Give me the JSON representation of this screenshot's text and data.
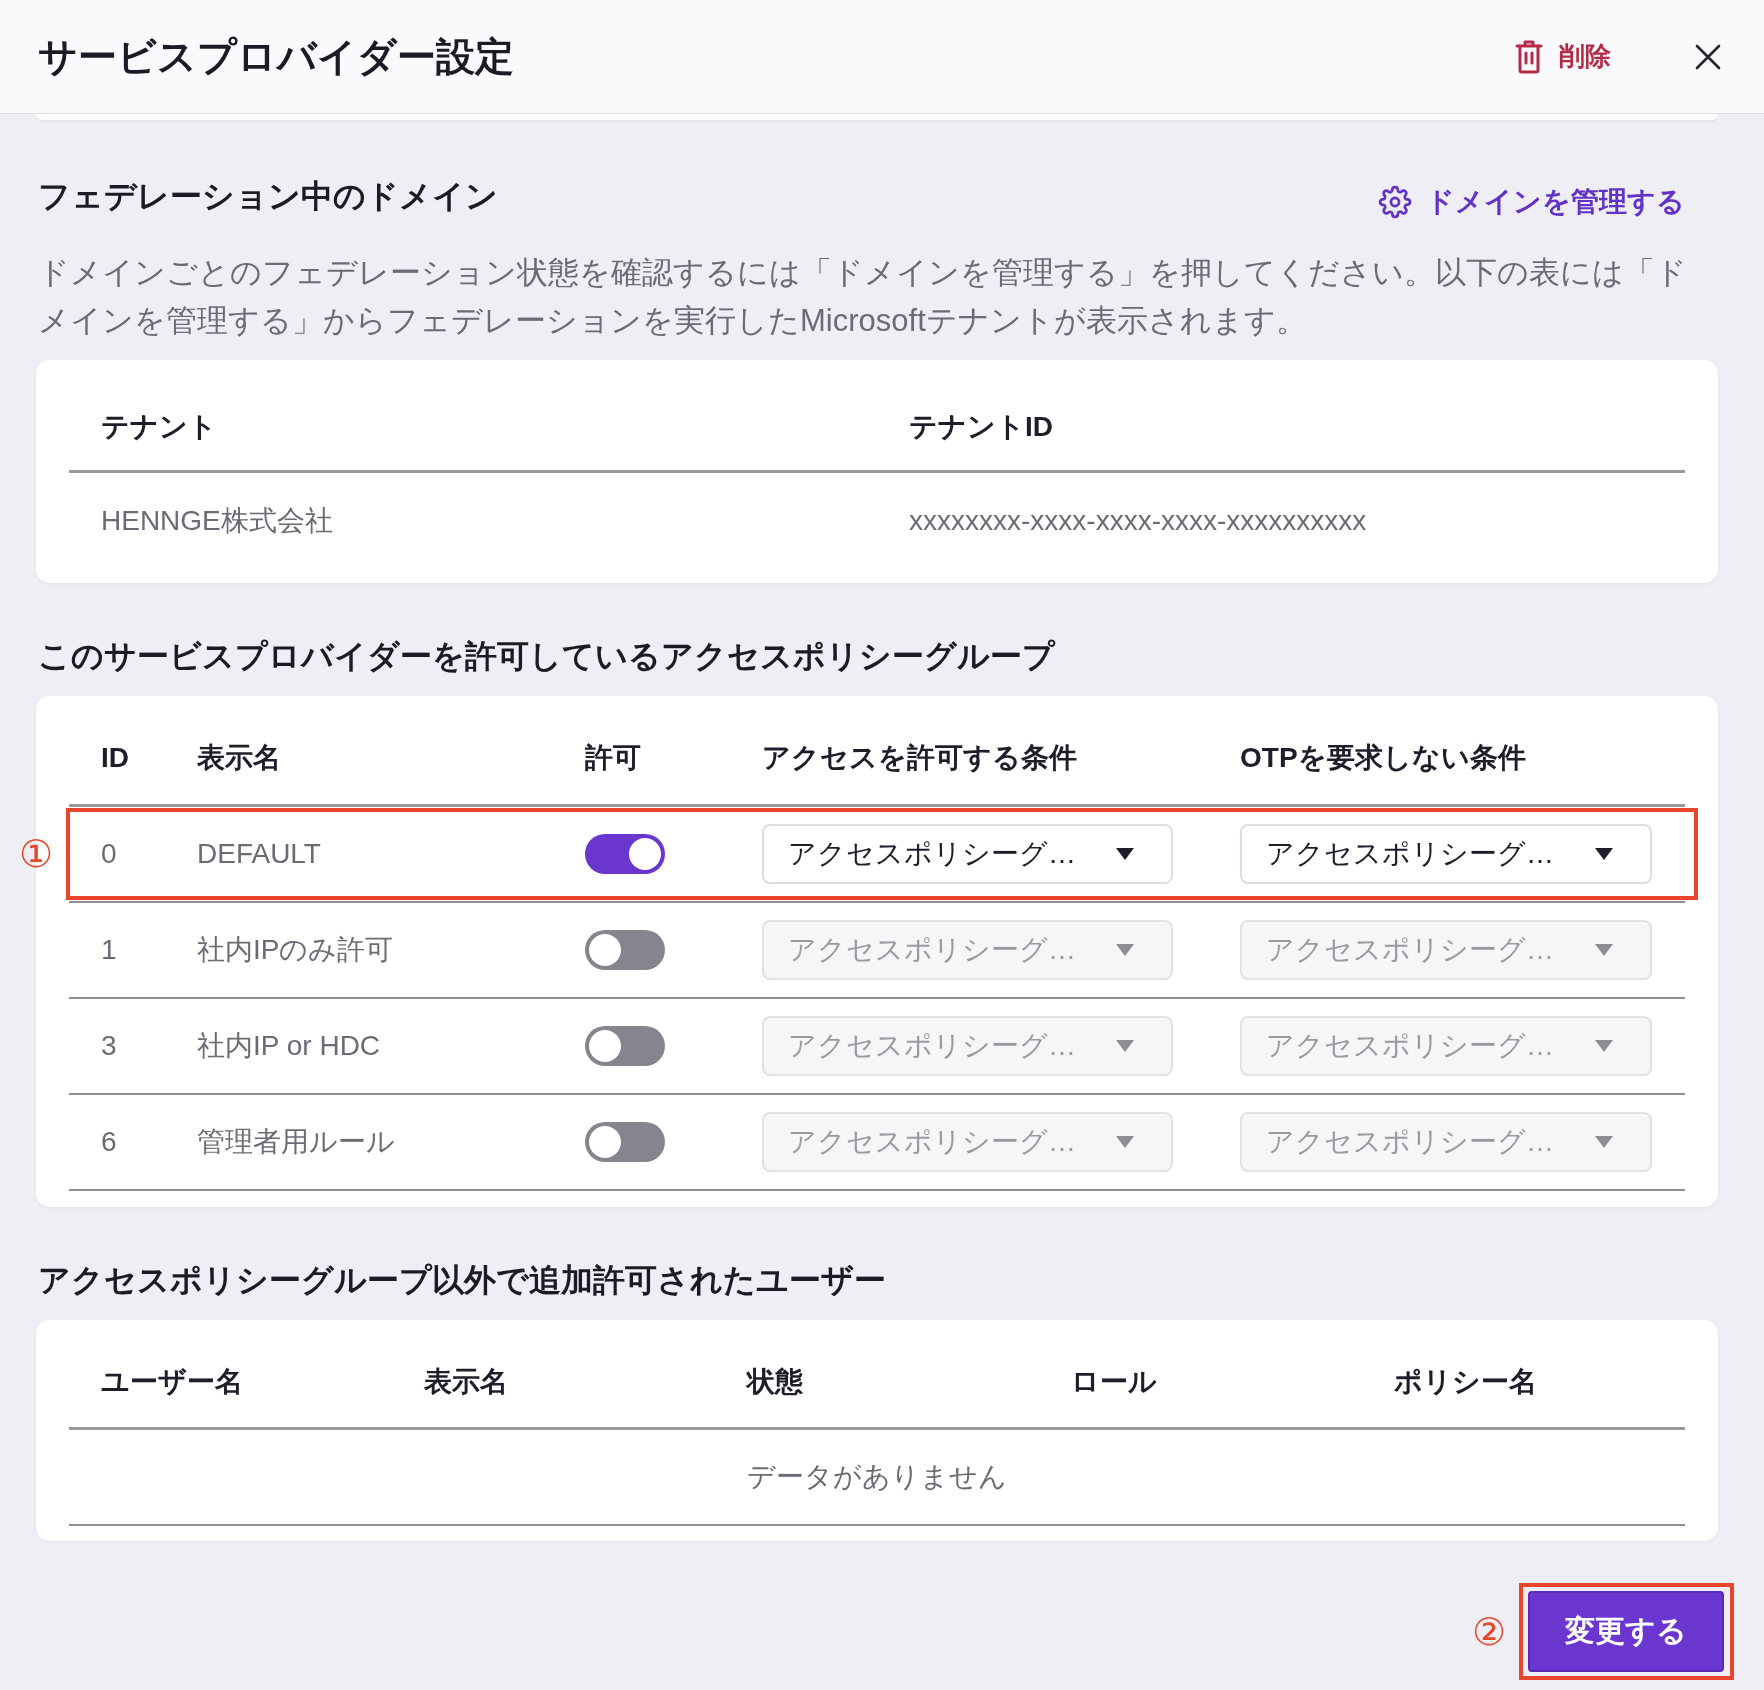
{
  "dialog": {
    "title": "サービスプロバイダー設定",
    "delete_button": "削除"
  },
  "federated_domains": {
    "heading": "フェデレーション中のドメイン",
    "manage_link": "ドメインを管理する",
    "description": "ドメインごとのフェデレーション状態を確認するには「ドメインを管理する」を押してください。以下の表には「ドメインを管理する」からフェデレーションを実行したMicrosoftテナントが表示されます。",
    "columns": [
      "テナント",
      "テナントID"
    ],
    "rows": [
      [
        "HENNGE株式会社",
        "xxxxxxxx-xxxx-xxxx-xxxx-xxxxxxxxxx"
      ]
    ]
  },
  "access_policy_groups": {
    "heading": "このサービスプロバイダーを許可しているアクセスポリシーグループ",
    "columns": [
      "ID",
      "表示名",
      "許可",
      "アクセスを許可する条件",
      "OTPを要求しない条件"
    ],
    "rows": [
      {
        "id": "0",
        "name": "DEFAULT",
        "allowed": true,
        "access_condition": {
          "value": "アクセスポリシーグ…",
          "disabled": false
        },
        "otp_condition": {
          "value": "アクセスポリシーグ…",
          "disabled": false
        },
        "callout": "①"
      },
      {
        "id": "1",
        "name": "社内IPのみ許可",
        "allowed": false,
        "access_condition": {
          "value": "アクセスポリシーグ…",
          "disabled": true
        },
        "otp_condition": {
          "value": "アクセスポリシーグ…",
          "disabled": true
        }
      },
      {
        "id": "3",
        "name": "社内IP or HDC",
        "allowed": false,
        "access_condition": {
          "value": "アクセスポリシーグ…",
          "disabled": true
        },
        "otp_condition": {
          "value": "アクセスポリシーグ…",
          "disabled": true
        }
      },
      {
        "id": "6",
        "name": "管理者用ルール",
        "allowed": false,
        "access_condition": {
          "value": "アクセスポリシーグ…",
          "disabled": true
        },
        "otp_condition": {
          "value": "アクセスポリシーグ…",
          "disabled": true
        }
      }
    ]
  },
  "additional_users": {
    "heading": "アクセスポリシーグループ以外で追加許可されたユーザー",
    "columns": [
      "ユーザー名",
      "表示名",
      "状態",
      "ロール",
      "ポリシー名"
    ],
    "empty_text": "データがありません"
  },
  "save_button": {
    "label": "変更する",
    "callout": "②"
  }
}
